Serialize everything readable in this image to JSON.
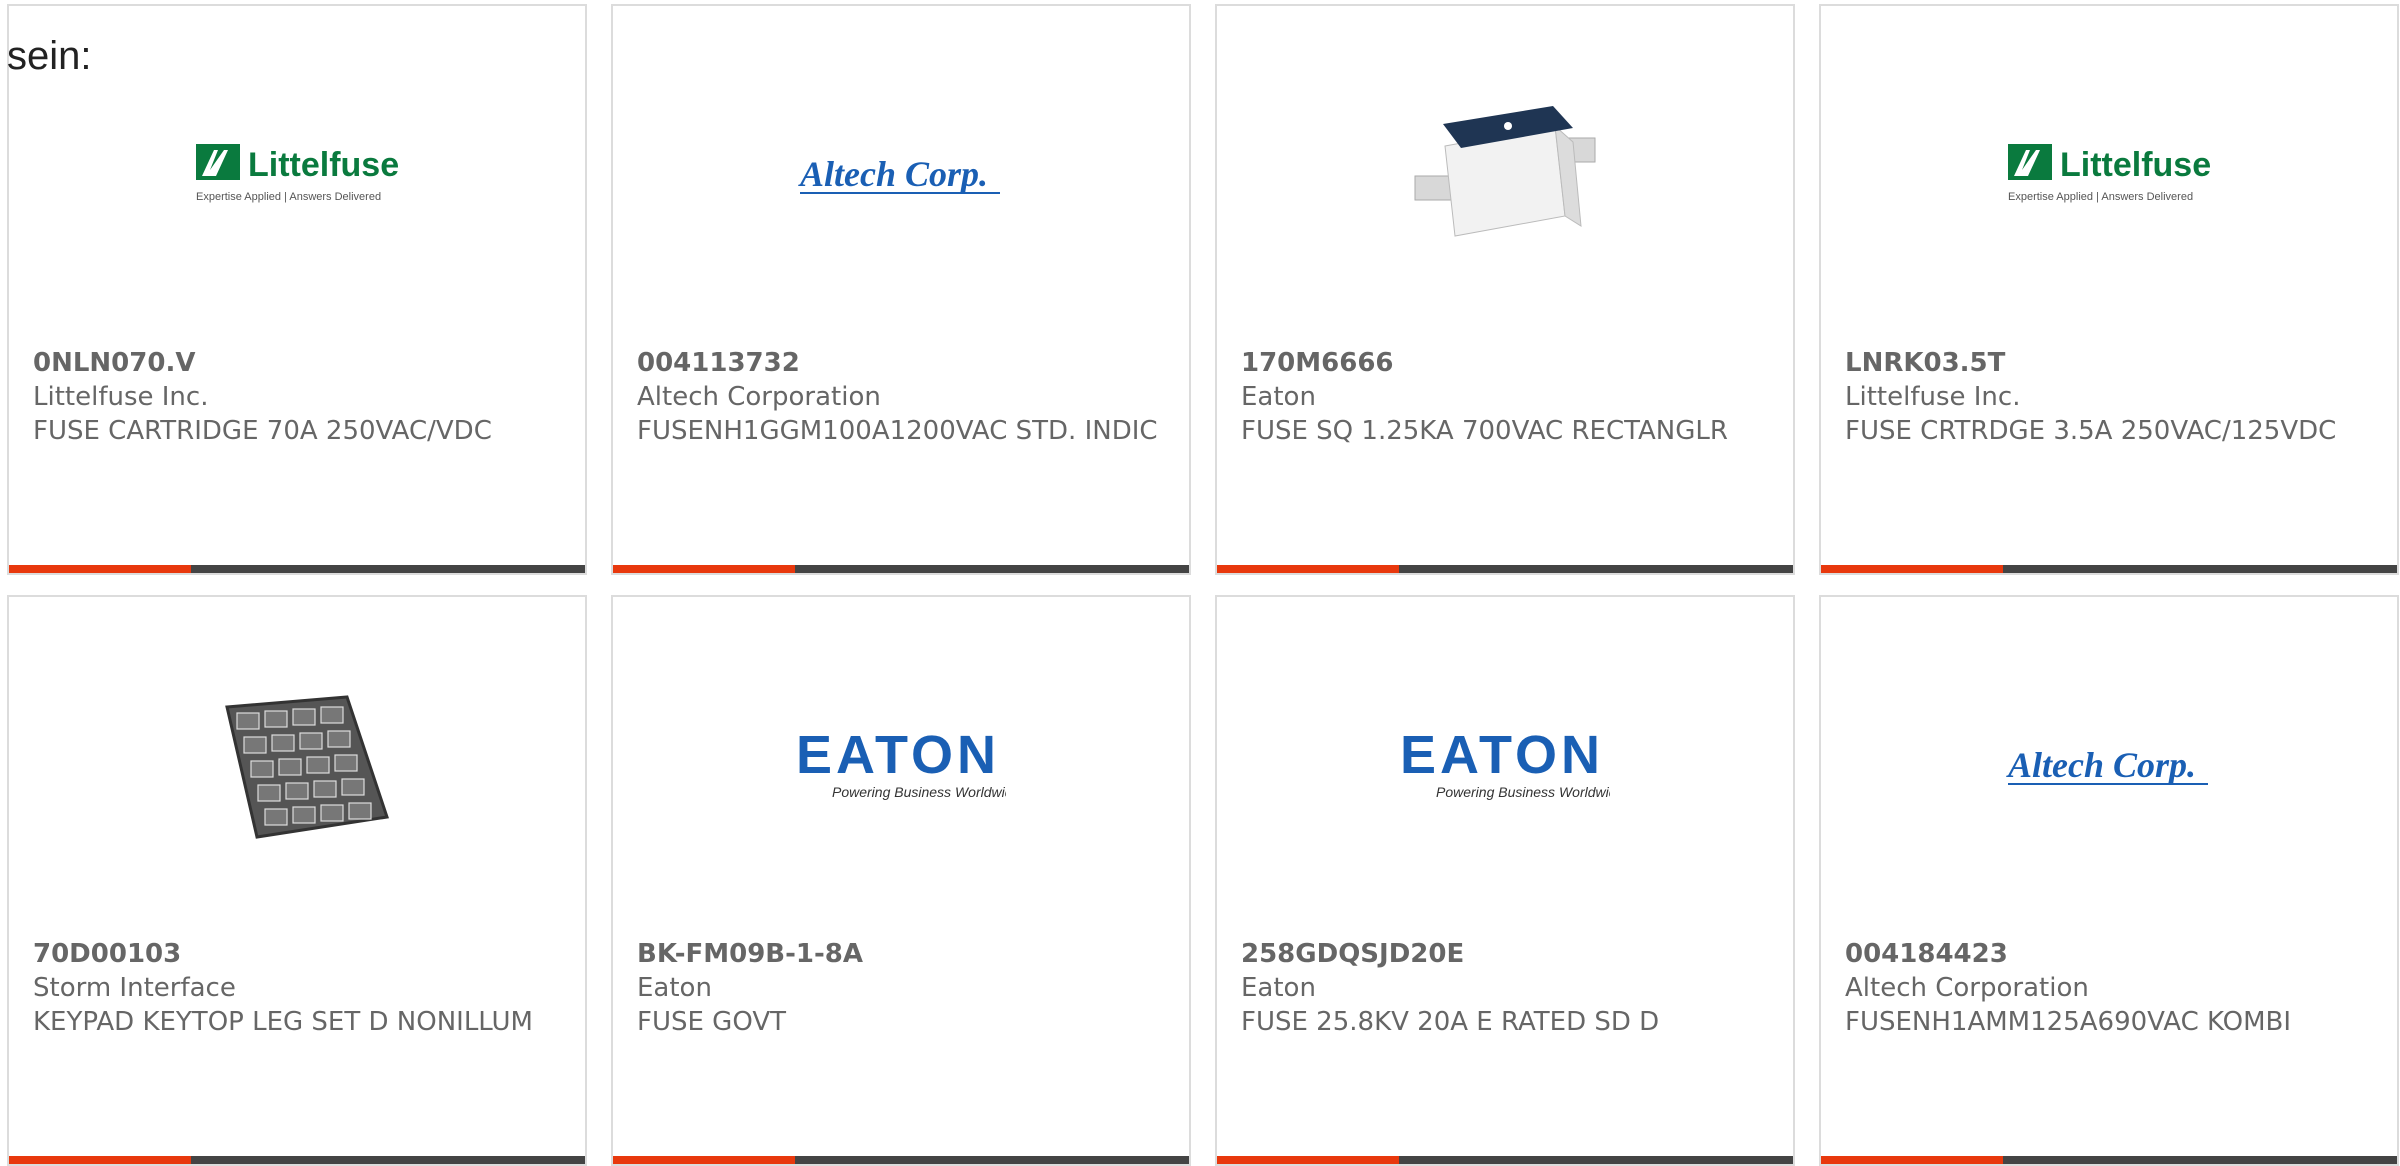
{
  "intro": "sein:",
  "colors": {
    "accent": "#e8380d",
    "bar": "#444444",
    "text": "#666666",
    "border": "#dcdcdc",
    "littelfuse_green": "#0a7a3e",
    "brand_blue": "#1a5fb4"
  },
  "products": [
    {
      "part_number": "0NLN070.V",
      "manufacturer": "Littelfuse Inc.",
      "description": "FUSE CARTRIDGE 70A 250VAC/VDC",
      "image": "littelfuse-logo",
      "logo": {
        "brand": "Littelfuse",
        "tagline": "Expertise Applied | Answers Delivered"
      }
    },
    {
      "part_number": "004113732",
      "manufacturer": "Altech Corporation",
      "description": "FUSENH1GGM100A1200VAC STD. INDIC",
      "image": "altech-logo",
      "logo": {
        "brand": "Altech Corp.",
        "tagline": ""
      }
    },
    {
      "part_number": "170M6666",
      "manufacturer": "Eaton",
      "description": "FUSE SQ 1.25KA 700VAC RECTANGLR",
      "image": "square-fuse-photo",
      "logo": {
        "brand": "",
        "tagline": ""
      }
    },
    {
      "part_number": "LNRK03.5T",
      "manufacturer": "Littelfuse Inc.",
      "description": "FUSE CRTRDGE 3.5A 250VAC/125VDC",
      "image": "littelfuse-logo",
      "logo": {
        "brand": "Littelfuse",
        "tagline": "Expertise Applied | Answers Delivered"
      }
    },
    {
      "part_number": "70D00103",
      "manufacturer": "Storm Interface",
      "description": "KEYPAD KEYTOP LEG SET D NONILLUM",
      "image": "keypad-photo",
      "logo": {
        "brand": "",
        "tagline": ""
      }
    },
    {
      "part_number": "BK-FM09B-1-8A",
      "manufacturer": "Eaton",
      "description": "FUSE GOVT",
      "image": "eaton-logo",
      "logo": {
        "brand": "EATON",
        "tagline": "Powering Business Worldwide"
      }
    },
    {
      "part_number": "258GDQSJD20E",
      "manufacturer": "Eaton",
      "description": "FUSE 25.8KV 20A E RATED SD D",
      "image": "eaton-logo",
      "logo": {
        "brand": "EATON",
        "tagline": "Powering Business Worldwide"
      }
    },
    {
      "part_number": "004184423",
      "manufacturer": "Altech Corporation",
      "description": "FUSENH1AMM125A690VAC KOMBI",
      "image": "altech-logo",
      "logo": {
        "brand": "Altech Corp.",
        "tagline": ""
      }
    }
  ]
}
